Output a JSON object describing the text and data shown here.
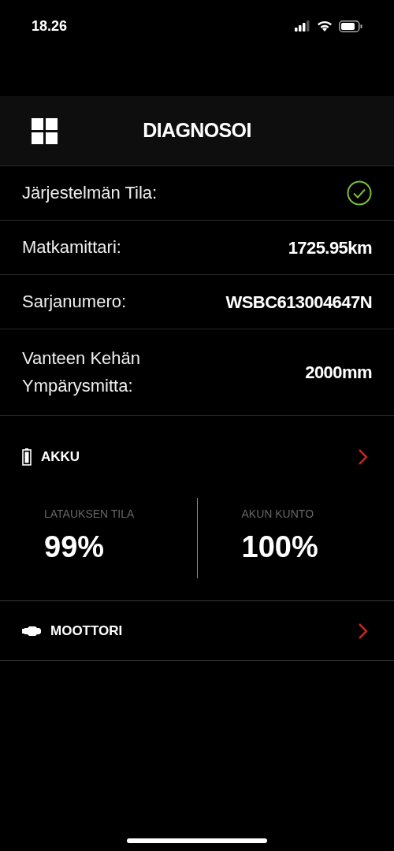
{
  "status_bar": {
    "time": "18.26"
  },
  "header": {
    "title": "DIAGNOSOI"
  },
  "info_rows": [
    {
      "kind": "status",
      "label": "Järjestelmän Tila:",
      "ok": true
    },
    {
      "kind": "value",
      "label": "Matkamittari:",
      "value": "1725.95km"
    },
    {
      "kind": "value",
      "label": "Sarjanumero:",
      "value": "WSBC613004647N"
    },
    {
      "kind": "value",
      "label": "Vanteen Kehän Ympärysmitta:",
      "value": "2000mm"
    }
  ],
  "sections": [
    {
      "kind": "battery",
      "title": "AKKU",
      "stats": [
        {
          "label": "LATAUKSEN TILA",
          "value": "99%"
        },
        {
          "label": "AKUN KUNTO",
          "value": "100%"
        }
      ]
    },
    {
      "kind": "motor",
      "title": "MOOTTORI"
    }
  ]
}
